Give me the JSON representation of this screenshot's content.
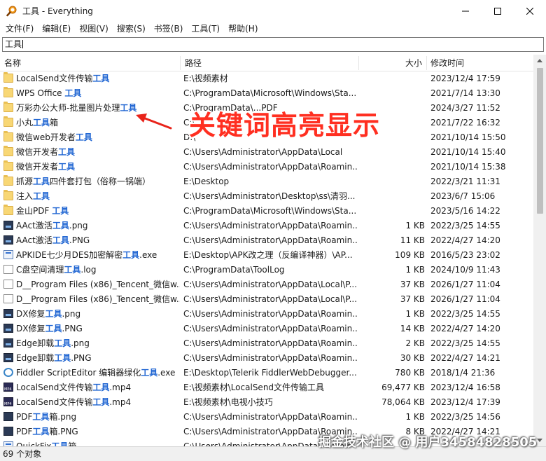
{
  "window": {
    "title": "工具 - Everything",
    "controls": {
      "minimize": "minimize-icon",
      "maximize": "maximize-icon",
      "close": "close-icon"
    }
  },
  "menu": [
    "文件(F)",
    "编辑(E)",
    "视图(V)",
    "搜索(S)",
    "书签(B)",
    "工具(T)",
    "帮助(H)"
  ],
  "search": {
    "value": "工具"
  },
  "columns": {
    "name": "名称",
    "path": "路径",
    "size": "大小",
    "modified": "修改时间"
  },
  "rows": [
    {
      "icon": "folder",
      "pre": "LocalSend文件传输",
      "hl": "工具",
      "post": "",
      "path": "E:\\视频素材",
      "size": "",
      "date": "2023/12/4 17:59"
    },
    {
      "icon": "folder",
      "pre": "WPS Office ",
      "hl": "工具",
      "post": "",
      "path": "C:\\ProgramData\\Microsoft\\Windows\\Sta...",
      "size": "",
      "date": "2021/7/14 13:30"
    },
    {
      "icon": "folder",
      "pre": "万彩办公大师-批量图片处理",
      "hl": "工具",
      "post": "",
      "path": "C:\\ProgramData\\...PDF",
      "size": "",
      "date": "2024/3/27 11:52"
    },
    {
      "icon": "folder",
      "pre": "小丸",
      "hl": "工具",
      "post": "箱",
      "path": "C:\\",
      "size": "",
      "date": "2021/7/22 16:32"
    },
    {
      "icon": "folder",
      "pre": "微信web开发者",
      "hl": "工具",
      "post": "",
      "path": "D:\\",
      "size": "",
      "date": "2021/10/14 15:50"
    },
    {
      "icon": "folder",
      "pre": "微信开发者",
      "hl": "工具",
      "post": "",
      "path": "C:\\Users\\Administrator\\AppData\\Local",
      "size": "",
      "date": "2021/10/14 15:40"
    },
    {
      "icon": "folder",
      "pre": "微信开发者",
      "hl": "工具",
      "post": "",
      "path": "C:\\Users\\Administrator\\AppData\\Roamin...",
      "size": "",
      "date": "2021/10/14 15:38"
    },
    {
      "icon": "folder",
      "pre": "抓源",
      "hl": "工具",
      "post": "四件套打包（俗称一锅端）",
      "path": "E:\\Desktop",
      "size": "",
      "date": "2022/3/21 11:31"
    },
    {
      "icon": "folder",
      "pre": "注入",
      "hl": "工具",
      "post": "",
      "path": "C:\\Users\\Administrator\\Desktop\\ss\\清羽...",
      "size": "",
      "date": "2023/6/7 15:06"
    },
    {
      "icon": "folder",
      "pre": "金山PDF ",
      "hl": "工具",
      "post": "",
      "path": "C:\\ProgramData\\Microsoft\\Windows\\Sta...",
      "size": "",
      "date": "2023/5/16 14:22"
    },
    {
      "icon": "img",
      "pre": "AAct激活",
      "hl": "工具",
      "post": ".png",
      "path": "C:\\Users\\Administrator\\AppData\\Roamin...",
      "size": "1 KB",
      "date": "2022/3/25 14:55"
    },
    {
      "icon": "img",
      "pre": "AAct激活",
      "hl": "工具",
      "post": ".PNG",
      "path": "C:\\Users\\Administrator\\AppData\\Roamin...",
      "size": "11 KB",
      "date": "2022/4/27 14:20"
    },
    {
      "icon": "exe",
      "pre": "APKIDE七少月DES加密解密",
      "hl": "工具",
      "post": ".exe",
      "path": "E:\\Desktop\\APK改之理（反编译神器）\\AP...",
      "size": "109 KB",
      "date": "2016/5/23 23:02"
    },
    {
      "icon": "doc",
      "pre": "C盘空间清理",
      "hl": "工具",
      "post": ".log",
      "path": "C:\\ProgramData\\ToolLog",
      "size": "1 KB",
      "date": "2024/10/9 11:43"
    },
    {
      "icon": "doc",
      "pre": "D__Program Files (x86)_Tencent_微信w...",
      "hl": "",
      "post": "",
      "path": "C:\\Users\\Administrator\\AppData\\Local\\P...",
      "size": "37 KB",
      "date": "2026/1/27 11:04"
    },
    {
      "icon": "doc",
      "pre": "D__Program Files (x86)_Tencent_微信w...",
      "hl": "",
      "post": "",
      "path": "C:\\Users\\Administrator\\AppData\\Local\\P...",
      "size": "37 KB",
      "date": "2026/1/27 11:04"
    },
    {
      "icon": "img",
      "pre": "DX修复",
      "hl": "工具",
      "post": ".png",
      "path": "C:\\Users\\Administrator\\AppData\\Roamin...",
      "size": "1 KB",
      "date": "2022/3/25 14:55"
    },
    {
      "icon": "img",
      "pre": "DX修复",
      "hl": "工具",
      "post": ".PNG",
      "path": "C:\\Users\\Administrator\\AppData\\Roamin...",
      "size": "14 KB",
      "date": "2022/4/27 14:20"
    },
    {
      "icon": "img",
      "pre": "Edge卸载",
      "hl": "工具",
      "post": ".png",
      "path": "C:\\Users\\Administrator\\AppData\\Roamin...",
      "size": "2 KB",
      "date": "2022/3/25 14:55"
    },
    {
      "icon": "img",
      "pre": "Edge卸载",
      "hl": "工具",
      "post": ".PNG",
      "path": "C:\\Users\\Administrator\\AppData\\Roamin...",
      "size": "30 KB",
      "date": "2022/4/27 14:21"
    },
    {
      "icon": "fid",
      "pre": "Fiddler ScriptEditor 编辑器绿化",
      "hl": "工具",
      "post": ".exe",
      "path": "E:\\Desktop\\Telerik FiddlerWebDebugger...",
      "size": "780 KB",
      "date": "2018/1/4 21:36"
    },
    {
      "icon": "mp4",
      "pre": "LocalSend文件传输",
      "hl": "工具",
      "post": ".mp4",
      "path": "E:\\视频素材\\LocalSend文件传输工具",
      "size": "69,477 KB",
      "date": "2023/12/4 16:58"
    },
    {
      "icon": "mp4",
      "pre": "LocalSend文件传输",
      "hl": "工具",
      "post": ".mp4",
      "path": "E:\\视频素材\\电视小技巧",
      "size": "78,064 KB",
      "date": "2023/12/4 17:39"
    },
    {
      "icon": "pdf",
      "pre": "PDF",
      "hl": "工具",
      "post": "箱.png",
      "path": "C:\\Users\\Administrator\\AppData\\Roamin...",
      "size": "1 KB",
      "date": "2022/3/25 14:56"
    },
    {
      "icon": "pdf",
      "pre": "PDF",
      "hl": "工具",
      "post": "箱.PNG",
      "path": "C:\\Users\\Administrator\\AppData\\Roamin...",
      "size": "8 KB",
      "date": "2022/4/27 14:21"
    },
    {
      "icon": "exe",
      "pre": "QuickFix",
      "hl": "工具",
      "post": "箱",
      "path": "C:\\Users\\Administrator\\AppData\\Roamin...",
      "size": "",
      "date": ""
    }
  ],
  "status": {
    "count": "69 个对象"
  },
  "annotation": {
    "text": "关键词高亮显示",
    "color": "#ff2f21"
  },
  "watermark": "掘金技术社区 @ 用户34584828505",
  "colors": {
    "highlight": "#1e64d2"
  }
}
